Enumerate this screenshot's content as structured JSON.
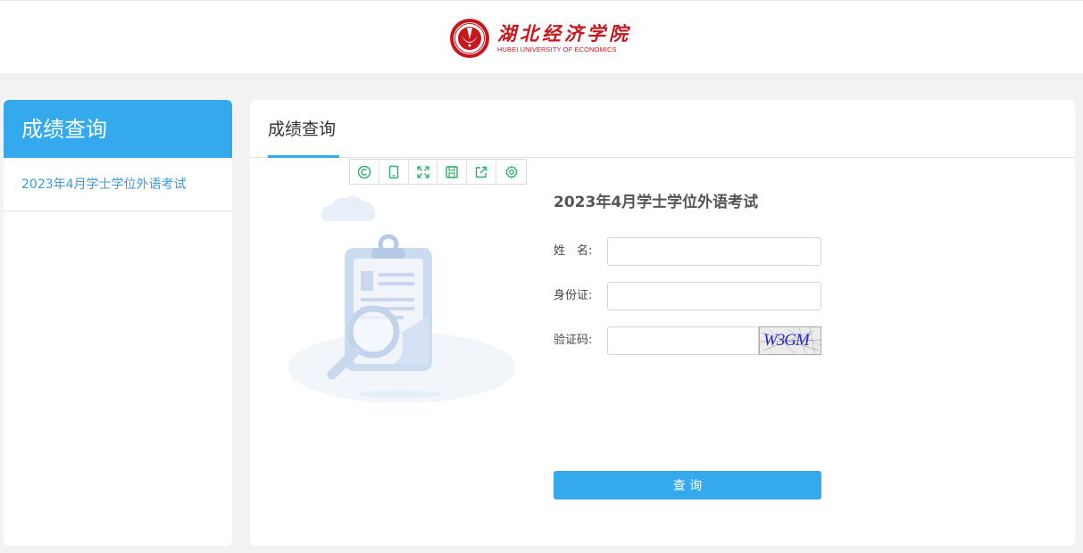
{
  "header": {
    "logo_cn": "湖北经济学院",
    "logo_en": "HUBEI UNIVERSITY OF ECONOMICS"
  },
  "sidebar": {
    "title": "成绩查询",
    "items": [
      {
        "label": "2023年4月学士学位外语考试"
      }
    ]
  },
  "main": {
    "tab_label": "成绩查询",
    "toolbar_icons": [
      "copyright-icon",
      "tablet-icon",
      "fullscreen-icon",
      "save-icon",
      "share-icon",
      "gear-icon"
    ],
    "form": {
      "title": "2023年4月学士学位外语考试",
      "name_label": "姓　名:",
      "name_value": "",
      "id_label": "身份证:",
      "id_value": "",
      "captcha_label": "验证码:",
      "captcha_value": "",
      "captcha_image_text": "W3GM",
      "submit_label": "查 询"
    }
  },
  "colors": {
    "accent": "#35a9ed",
    "brand": "#c8161d",
    "toolbar_icon": "#2fae6e"
  }
}
